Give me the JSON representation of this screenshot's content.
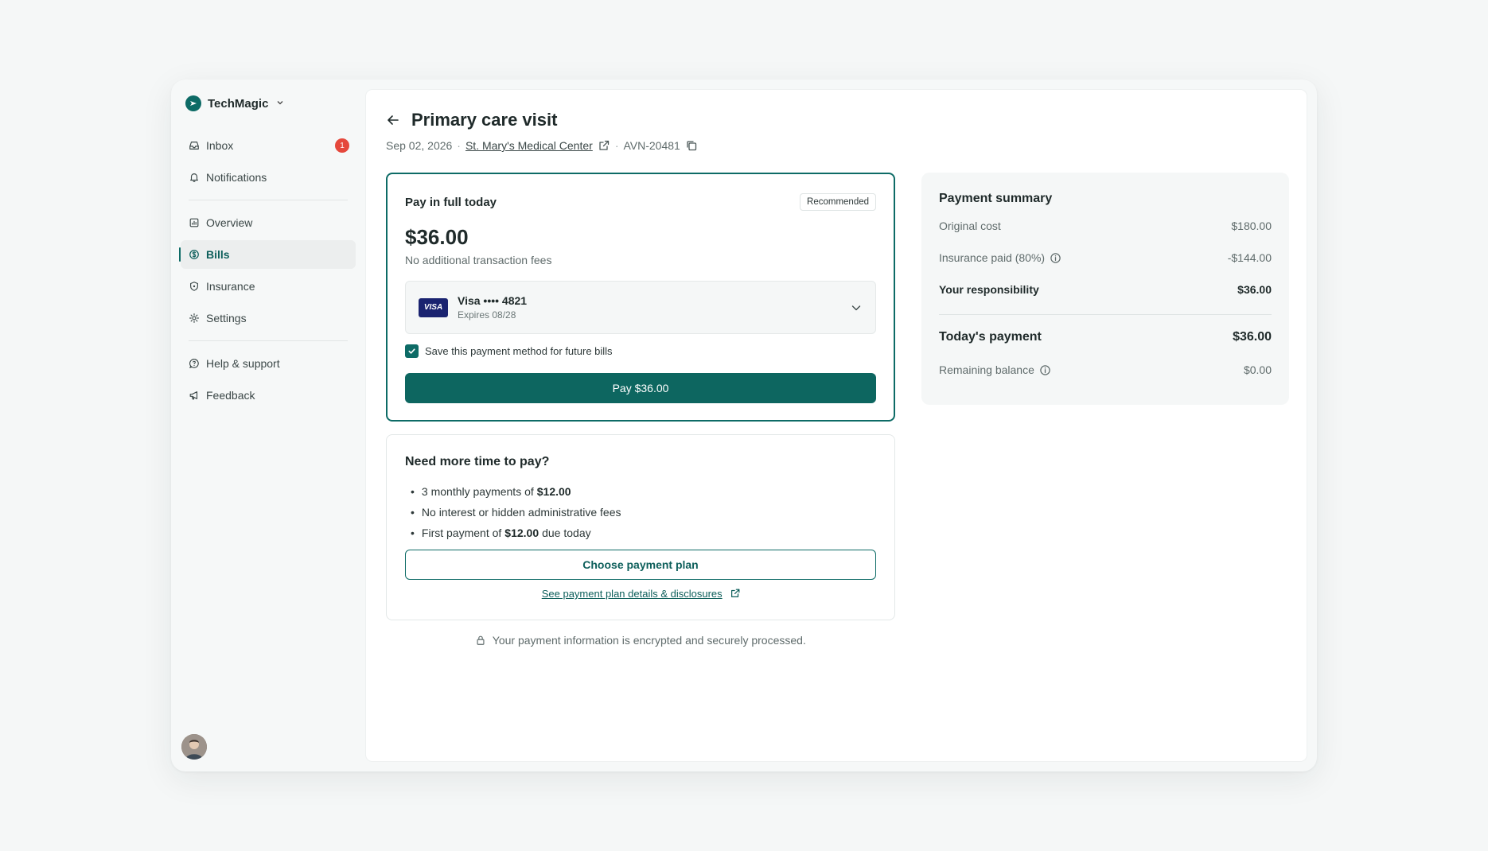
{
  "brand": {
    "name": "TechMagic"
  },
  "sidebar": {
    "items": [
      {
        "label": "Inbox",
        "badge": "1"
      },
      {
        "label": "Notifications"
      },
      {
        "label": "Overview"
      },
      {
        "label": "Bills"
      },
      {
        "label": "Insurance"
      },
      {
        "label": "Settings"
      },
      {
        "label": "Help & support"
      },
      {
        "label": "Feedback"
      }
    ]
  },
  "header": {
    "title": "Primary care visit",
    "date": "Sep 02, 2026",
    "provider": "St. Mary's Medical Center",
    "account": "AVN-20481"
  },
  "pay_full": {
    "title": "Pay in full today",
    "badge": "Recommended",
    "amount": "$36.00",
    "subtitle": "No additional transaction fees",
    "card_brand": "VISA",
    "card_name": "Visa •••• 4821",
    "card_expiry": "Expires 08/28",
    "save_label": "Save this payment method for future bills",
    "pay_button": "Pay $36.00"
  },
  "plan": {
    "title": "Need more time to pay?",
    "b1_pre": "3 monthly payments of",
    "b1_amount": "$12.00",
    "b2": "No interest or hidden administrative fees",
    "b3_pre": "First payment of",
    "b3_amount": "$12.00",
    "b3_post": "due today",
    "button": "Choose payment plan",
    "link": "See payment plan details & disclosures"
  },
  "secure_note": "Your payment information is encrypted and securely processed.",
  "summary": {
    "title": "Payment summary",
    "original_label": "Original cost",
    "original_value": "$180.00",
    "insurance_label": "Insurance paid (80%)",
    "insurance_value": "-$144.00",
    "responsibility_label": "Your responsibility",
    "responsibility_value": "$36.00",
    "today_label": "Today's payment",
    "today_value": "$36.00",
    "remaining_label": "Remaining balance",
    "remaining_value": "$0.00"
  },
  "colors": {
    "accent": "#0d6b66",
    "badge": "#e5483c",
    "visa": "#1a2370"
  }
}
